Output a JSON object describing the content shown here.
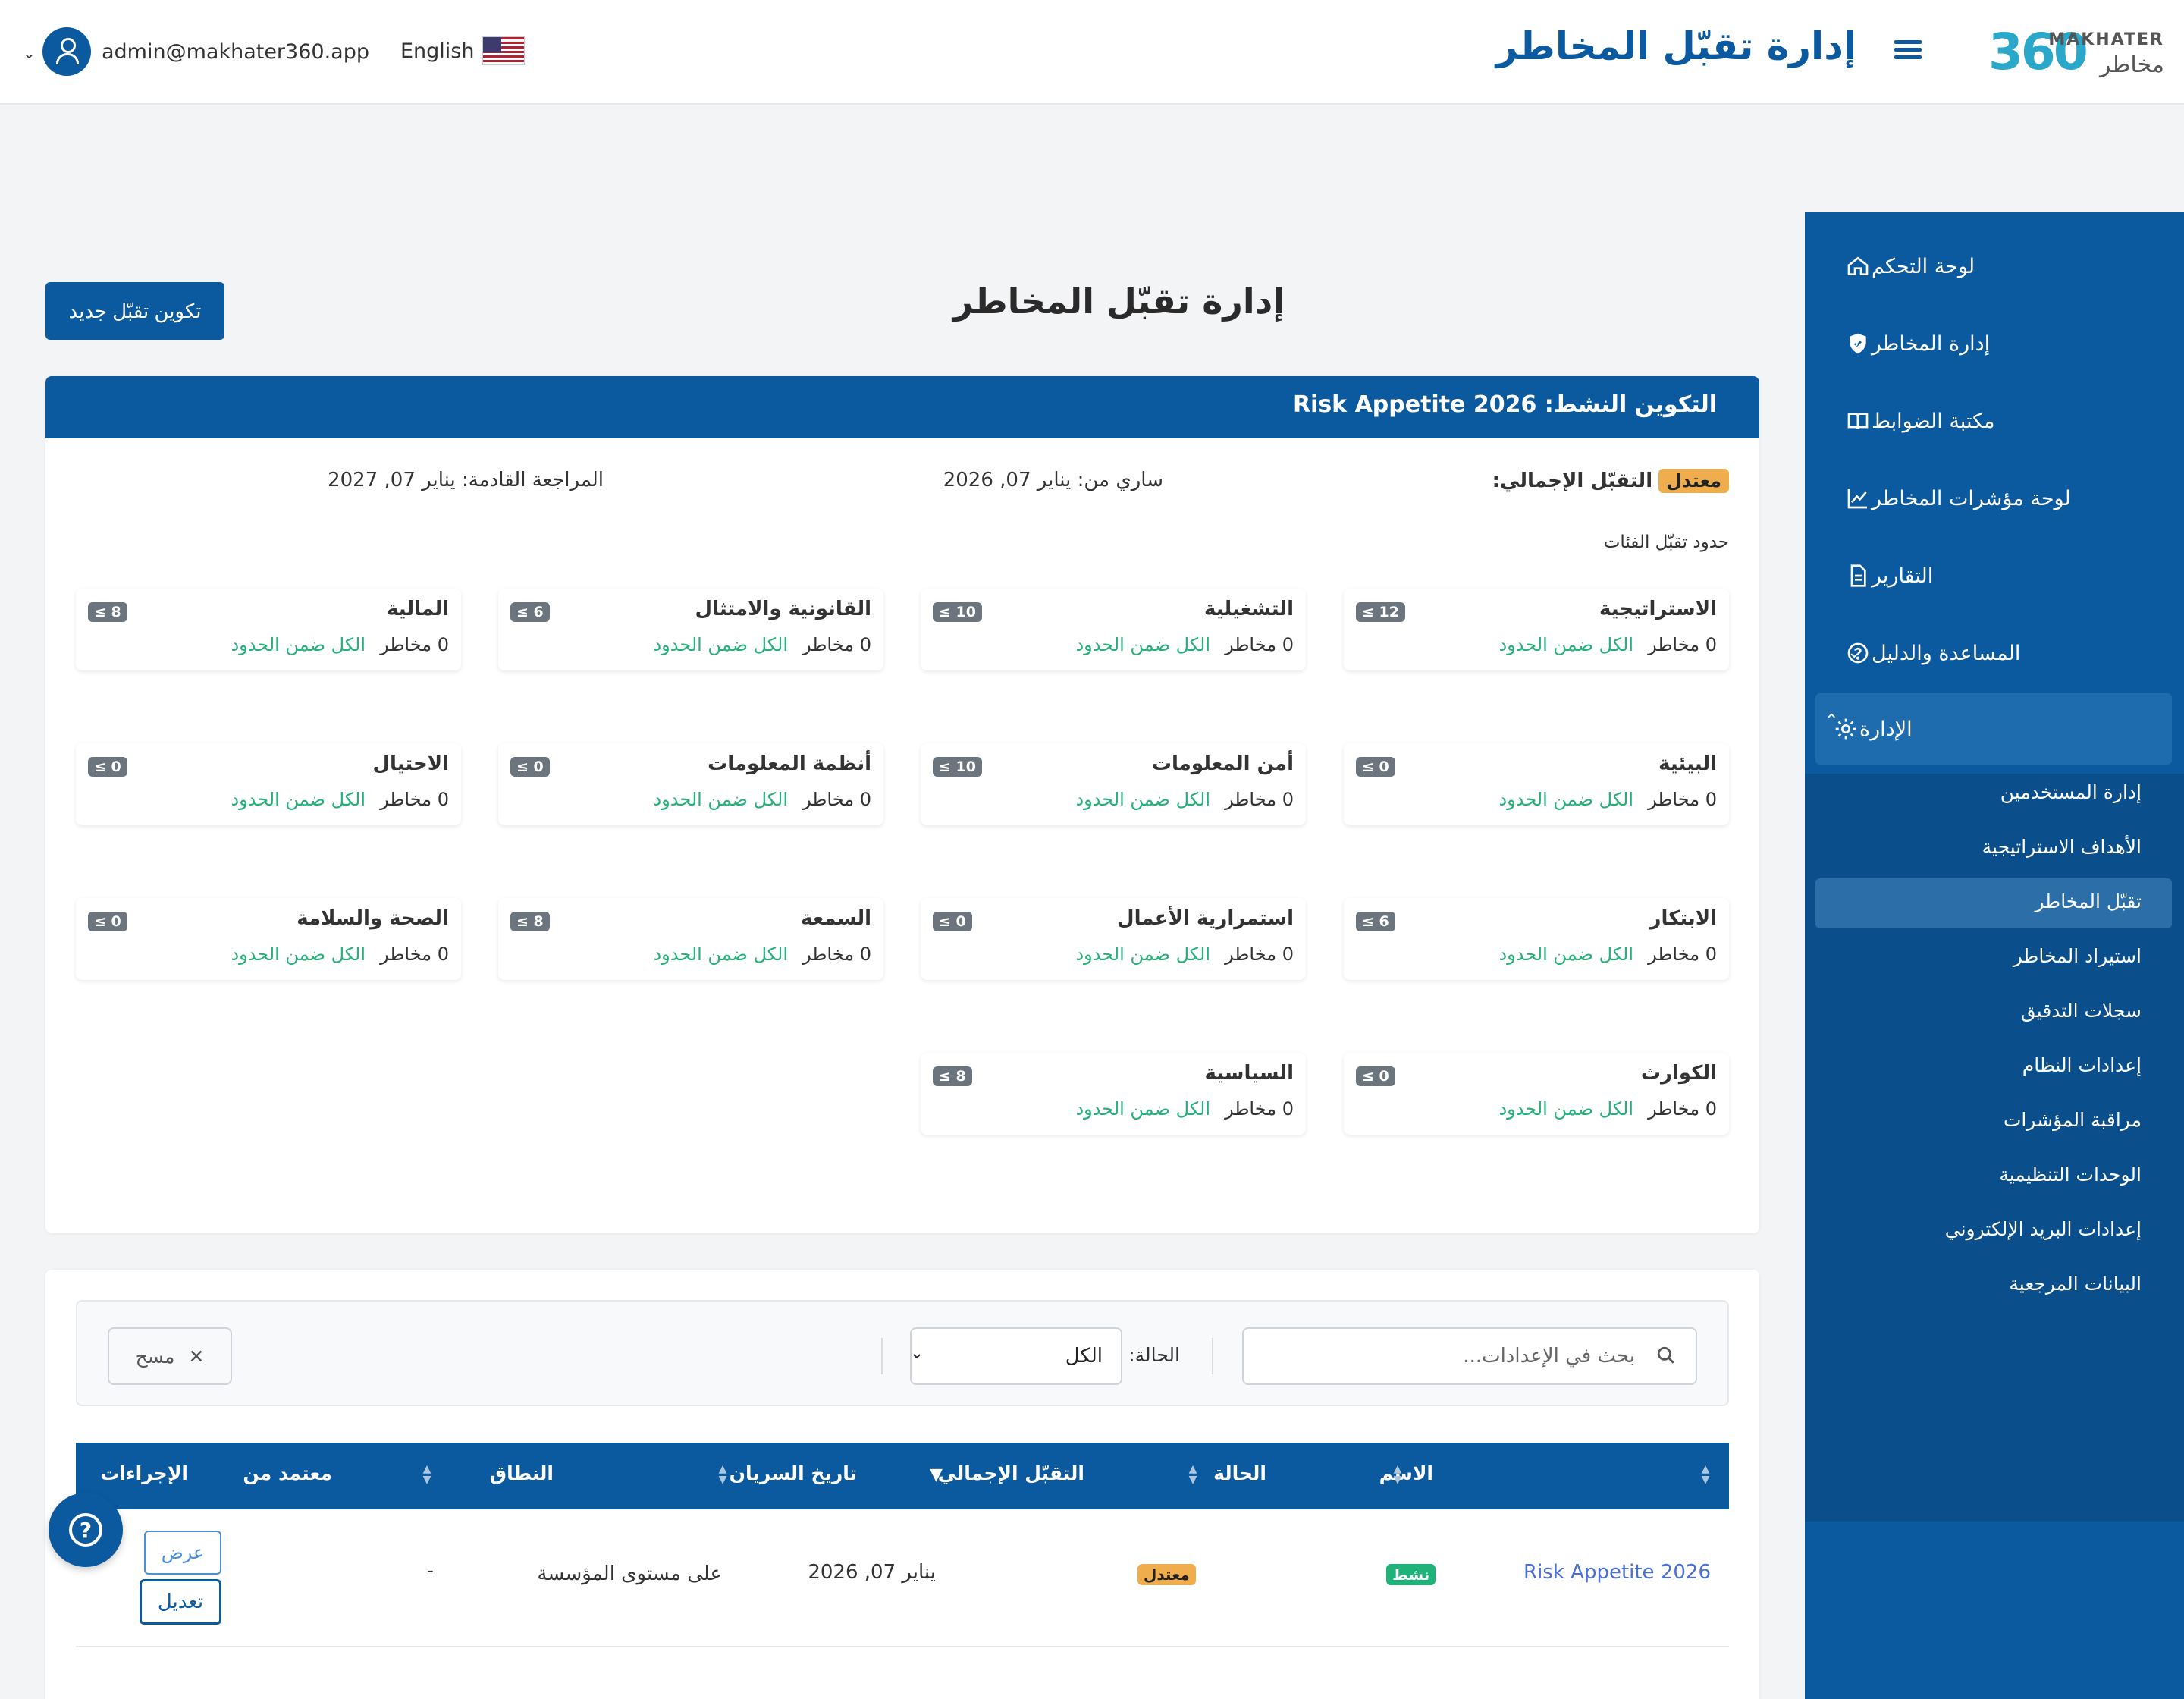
{
  "brand": {
    "logo_number": "360",
    "logo_en": "MAKHATER",
    "logo_ar": "مخاطر"
  },
  "header": {
    "title": "إدارة تقبّل المخاطر",
    "language": "English",
    "user_email": "admin@makhater360.app"
  },
  "sidebar": {
    "items": [
      {
        "label": "لوحة التحكم",
        "icon": "home-icon"
      },
      {
        "label": "إدارة المخاطر",
        "icon": "shield-icon",
        "expandable": true
      },
      {
        "label": "مكتبة الضوابط",
        "icon": "book-icon"
      },
      {
        "label": "لوحة مؤشرات المخاطر",
        "icon": "chart-line-icon"
      },
      {
        "label": "التقارير",
        "icon": "document-icon"
      },
      {
        "label": "المساعدة والدليل",
        "icon": "question-circle-icon",
        "expandable": true
      },
      {
        "label": "الإدارة",
        "icon": "gear-icon",
        "expandable": true,
        "expanded": true
      }
    ],
    "admin_sub": [
      "إدارة المستخدمين",
      "الأهداف الاستراتيجية",
      "تقبّل المخاطر",
      "استيراد المخاطر",
      "سجلات التدقيق",
      "إعدادات النظام",
      "مراقبة المؤشرات",
      "الوحدات التنظيمية",
      "إعدادات البريد الإلكتروني",
      "البيانات المرجعية"
    ],
    "active_sub": "تقبّل المخاطر"
  },
  "page": {
    "title": "إدارة تقبّل المخاطر",
    "new_button": "تكوين تقبّل جديد",
    "active_config": "التكوين النشط: Risk Appetite 2026",
    "overall_label": "التقبّل الإجمالي:",
    "overall_value": "معتدل",
    "effective": "ساري من: يناير 07, 2026",
    "next_review": "المراجعة القادمة: يناير 07, 2027",
    "categories_heading": "حدود تقبّل الفئات",
    "categories": [
      {
        "name": "الاستراتيجية",
        "limit": "≤ 12",
        "count": "0 مخاطر",
        "status": "الكل ضمن الحدود"
      },
      {
        "name": "التشغيلية",
        "limit": "≤ 10",
        "count": "0 مخاطر",
        "status": "الكل ضمن الحدود"
      },
      {
        "name": "القانونية والامتثال",
        "limit": "≤ 6",
        "count": "0 مخاطر",
        "status": "الكل ضمن الحدود"
      },
      {
        "name": "المالية",
        "limit": "≤ 8",
        "count": "0 مخاطر",
        "status": "الكل ضمن الحدود"
      },
      {
        "name": "البيئية",
        "limit": "≤ 0",
        "count": "0 مخاطر",
        "status": "الكل ضمن الحدود"
      },
      {
        "name": "أمن المعلومات",
        "limit": "≤ 10",
        "count": "0 مخاطر",
        "status": "الكل ضمن الحدود"
      },
      {
        "name": "أنظمة المعلومات",
        "limit": "≤ 0",
        "count": "0 مخاطر",
        "status": "الكل ضمن الحدود"
      },
      {
        "name": "الاحتيال",
        "limit": "≤ 0",
        "count": "0 مخاطر",
        "status": "الكل ضمن الحدود"
      },
      {
        "name": "الابتكار",
        "limit": "≤ 6",
        "count": "0 مخاطر",
        "status": "الكل ضمن الحدود"
      },
      {
        "name": "استمرارية الأعمال",
        "limit": "≤ 0",
        "count": "0 مخاطر",
        "status": "الكل ضمن الحدود"
      },
      {
        "name": "السمعة",
        "limit": "≤ 8",
        "count": "0 مخاطر",
        "status": "الكل ضمن الحدود"
      },
      {
        "name": "الصحة والسلامة",
        "limit": "≤ 0",
        "count": "0 مخاطر",
        "status": "الكل ضمن الحدود"
      },
      {
        "name": "الكوارث",
        "limit": "≤ 0",
        "count": "0 مخاطر",
        "status": "الكل ضمن الحدود"
      },
      {
        "name": "السياسية",
        "limit": "≤ 8",
        "count": "0 مخاطر",
        "status": "الكل ضمن الحدود"
      }
    ]
  },
  "filters": {
    "search_placeholder": "بحث في الإعدادات...",
    "status_label": "الحالة:",
    "status_selected": "الكل",
    "clear_label": "مسح"
  },
  "table": {
    "columns": [
      "الاسم",
      "الحالة",
      "التقبّل الإجمالي",
      "تاريخ السريان",
      "النطاق",
      "معتمد من",
      "الإجراءات"
    ],
    "rows": [
      {
        "name": "Risk Appetite 2026",
        "status": "نشط",
        "overall": "معتدل",
        "effective_date": "يناير 07, 2026",
        "scope": "على مستوى المؤسسة",
        "approved_by": "-",
        "view_label": "عرض",
        "edit_label": "تعديل"
      }
    ]
  },
  "colors": {
    "primary": "#0b5aa0",
    "success": "#28b07a",
    "warning": "#f0ad4e",
    "link": "#4a6fd6"
  }
}
